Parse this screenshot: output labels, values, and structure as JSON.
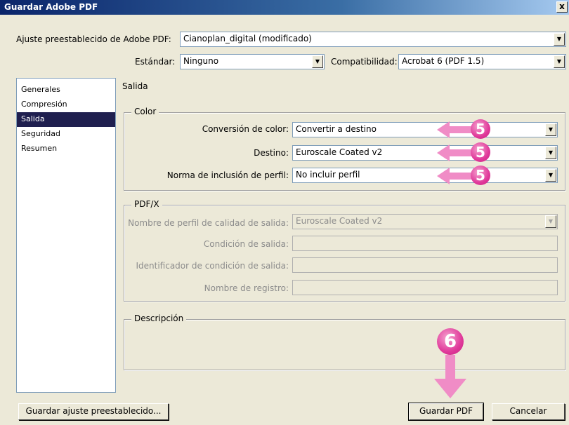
{
  "window": {
    "title": "Guardar Adobe PDF",
    "close_label": "x"
  },
  "preset": {
    "label": "Ajuste preestablecido de Adobe PDF:",
    "value": "Cianoplan_digital (modificado)"
  },
  "standard": {
    "label": "Estándar:",
    "value": "Ninguno"
  },
  "compat": {
    "label": "Compatibilidad:",
    "value": "Acrobat 6 (PDF 1.5)"
  },
  "sidebar": {
    "items": [
      {
        "label": "Generales"
      },
      {
        "label": "Compresión"
      },
      {
        "label": "Salida"
      },
      {
        "label": "Seguridad"
      },
      {
        "label": "Resumen"
      }
    ],
    "selected": "Salida"
  },
  "section_title": "Salida",
  "color_group": {
    "legend": "Color",
    "conversion": {
      "label": "Conversión de color:",
      "value": "Convertir a destino"
    },
    "destination": {
      "label": "Destino:",
      "value": "Euroscale Coated v2"
    },
    "profile_policy": {
      "label": "Norma de inclusión de perfil:",
      "value": "No incluir perfil"
    }
  },
  "pdfx_group": {
    "legend": "PDF/X",
    "profile_name": {
      "label": "Nombre de perfil de calidad de salida:",
      "value": "Euroscale Coated v2"
    },
    "output_condition": {
      "label": "Condición de salida:",
      "value": ""
    },
    "condition_id": {
      "label": "Identificador de condición de salida:",
      "value": ""
    },
    "registry_name": {
      "label": "Nombre de registro:",
      "value": ""
    }
  },
  "description_group": {
    "legend": "Descripción"
  },
  "callouts": {
    "step5": "5",
    "step6": "6",
    "color": "#e0399a"
  },
  "buttons": {
    "save_preset": "Guardar ajuste preestablecido...",
    "save_pdf": "Guardar PDF",
    "cancel": "Cancelar"
  }
}
